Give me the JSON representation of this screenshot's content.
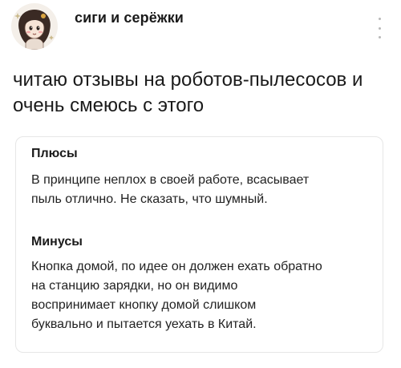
{
  "header": {
    "author_name": "сиги и серёжки",
    "avatar_icon": "girl-doodle-avatar",
    "more_icon": "vertical-dots-icon"
  },
  "post": {
    "text_lines": [
      "читаю отзывы на роботов-пылесосов и",
      "очень смеюсь с этого"
    ]
  },
  "review": {
    "pros": {
      "title": "Плюсы",
      "lines": [
        "В принципе неплох в своей работе, всасывает",
        "пыль отлично. Не сказать, что шумный."
      ]
    },
    "cons": {
      "title": "Минусы",
      "lines": [
        "Кнопка домой, по идее он должен ехать обратно",
        "на станцию зарядки, но он видимо",
        "воспринимает кнопку домой слишком",
        "буквально и пытается уехать в Китай."
      ]
    }
  }
}
